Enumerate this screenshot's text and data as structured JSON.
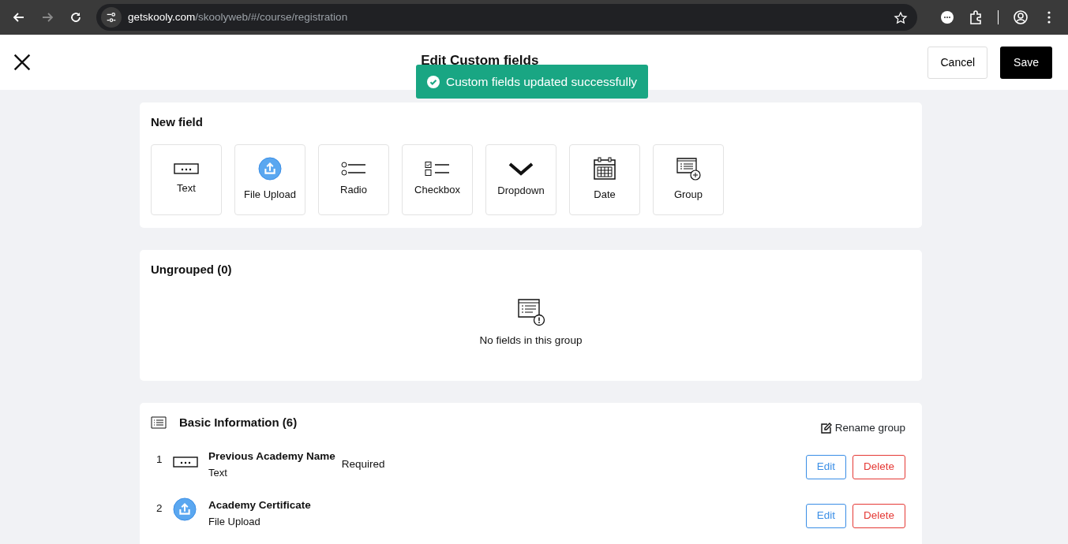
{
  "browser": {
    "url_host": "getskooly.com",
    "url_path": "/skoolyweb/#/course/registration",
    "forward_disabled": true
  },
  "header": {
    "title": "Edit Custom fields",
    "cancel": "Cancel",
    "save": "Save"
  },
  "toast": {
    "text": "Custom fields updated successfully"
  },
  "new_field": {
    "title": "New field",
    "types": [
      {
        "kind": "text",
        "label": "Text"
      },
      {
        "kind": "upload",
        "label": "File Upload"
      },
      {
        "kind": "radio",
        "label": "Radio"
      },
      {
        "kind": "checkbox",
        "label": "Checkbox"
      },
      {
        "kind": "dropdown",
        "label": "Dropdown"
      },
      {
        "kind": "date",
        "label": "Date"
      },
      {
        "kind": "group",
        "label": "Group"
      }
    ]
  },
  "ungrouped": {
    "title": "Ungrouped (0)",
    "empty": "No fields in this group"
  },
  "group": {
    "title": "Basic Information (6)",
    "rename": "Rename group",
    "fields": [
      {
        "number": "1",
        "kind": "text",
        "name": "Previous Academy Name",
        "type": "Text",
        "note": "Required",
        "edit": "Edit",
        "delete": "Delete"
      },
      {
        "number": "2",
        "kind": "upload",
        "name": "Academy Certificate",
        "type": "File Upload",
        "edit": "Edit",
        "delete": "Delete"
      }
    ]
  }
}
